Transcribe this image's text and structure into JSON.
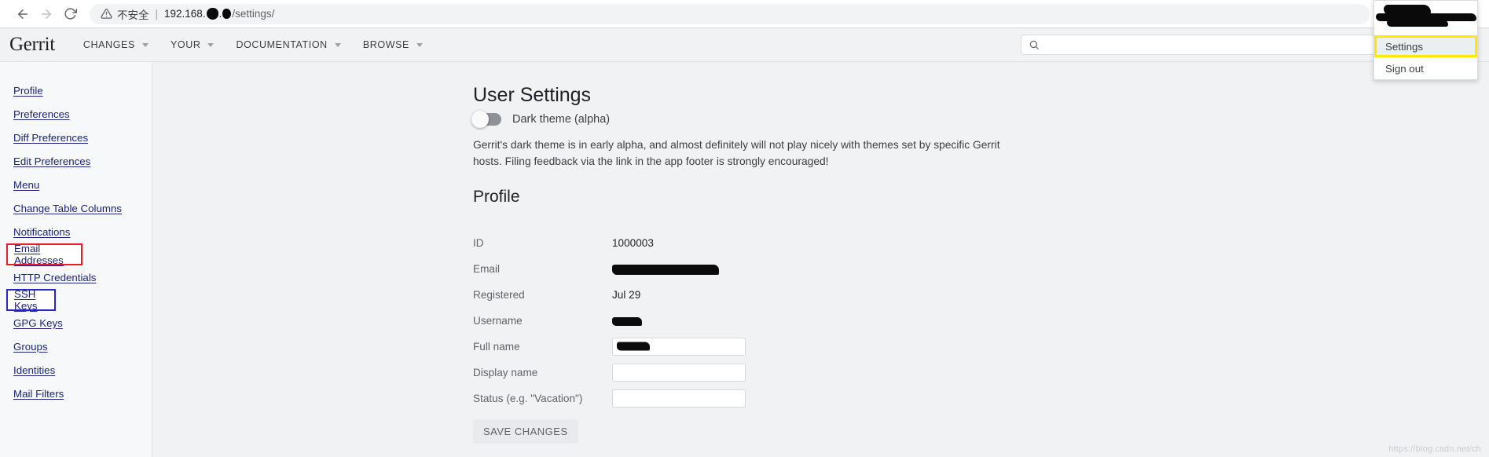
{
  "browser": {
    "back_icon": "arrow-left-icon",
    "forward_icon": "arrow-right-icon",
    "reload_icon": "reload-icon",
    "security_warning": "不安全",
    "url_host_prefix": "192.168.",
    "url_path": "/settings/",
    "star_icon": "star-icon",
    "extension_icon": "extension-icon",
    "puzzle_icon": "puzzle-icon",
    "profile_icon": "profile-avatar-icon"
  },
  "header": {
    "logo": "Gerrit",
    "nav": [
      {
        "label": "CHANGES",
        "has_caret": true
      },
      {
        "label": "YOUR",
        "has_caret": true
      },
      {
        "label": "DOCUMENTATION",
        "has_caret": true
      },
      {
        "label": "BROWSE",
        "has_caret": true
      }
    ],
    "search_placeholder": "",
    "search_value": "",
    "search_icon": "search-icon",
    "settings_gear_icon": "gear-icon",
    "avatar_icon": "user-avatar-icon"
  },
  "sidebar": {
    "items": [
      {
        "label": "Profile",
        "highlight": "none"
      },
      {
        "label": "Preferences",
        "highlight": "none"
      },
      {
        "label": "Diff Preferences",
        "highlight": "none"
      },
      {
        "label": "Edit Preferences",
        "highlight": "none"
      },
      {
        "label": "Menu",
        "highlight": "none"
      },
      {
        "label": "Change Table Columns",
        "highlight": "none"
      },
      {
        "label": "Notifications",
        "highlight": "none"
      },
      {
        "label": "Email Addresses",
        "highlight": "red"
      },
      {
        "label": "HTTP Credentials",
        "highlight": "none"
      },
      {
        "label": "SSH Keys",
        "highlight": "blue"
      },
      {
        "label": "GPG Keys",
        "highlight": "none"
      },
      {
        "label": "Groups",
        "highlight": "none"
      },
      {
        "label": "Identities",
        "highlight": "none"
      },
      {
        "label": "Mail Filters",
        "highlight": "none"
      }
    ]
  },
  "main": {
    "title": "User Settings",
    "dark_theme_label": "Dark theme (alpha)",
    "dark_theme_on": false,
    "description": "Gerrit's dark theme is in early alpha, and almost definitely will not play nicely with themes set by specific Gerrit hosts. Filing feedback via the link in the app footer is strongly encouraged!",
    "profile_section_title": "Profile",
    "profile_rows": [
      {
        "label": "ID",
        "value": "1000003",
        "type": "text"
      },
      {
        "label": "Email",
        "value": "",
        "type": "redacted-text"
      },
      {
        "label": "Registered",
        "value": "Jul 29",
        "type": "text"
      },
      {
        "label": "Username",
        "value": "",
        "type": "redacted-short"
      },
      {
        "label": "Full name",
        "value": "",
        "type": "input-redacted"
      },
      {
        "label": "Display name",
        "value": "",
        "type": "input"
      },
      {
        "label": "Status (e.g. \"Vacation\")",
        "value": "",
        "type": "input"
      }
    ],
    "save_button": "SAVE CHANGES"
  },
  "account_menu": {
    "settings_label": "Settings",
    "sign_out_label": "Sign out"
  },
  "watermark": "https://blog.csdn.net/ch",
  "colors": {
    "red_box": "#ec1c24",
    "blue_box": "#2a27c4",
    "yellow_box": "#ffe800",
    "link": "#1a237e"
  }
}
